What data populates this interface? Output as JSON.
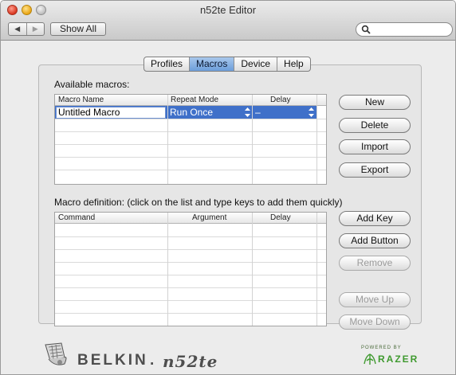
{
  "window": {
    "title": "n52te Editor"
  },
  "toolbar": {
    "show_all": "Show All",
    "search_placeholder": ""
  },
  "tabs": [
    {
      "label": "Profiles",
      "active": false
    },
    {
      "label": "Macros",
      "active": true
    },
    {
      "label": "Device",
      "active": false
    },
    {
      "label": "Help",
      "active": false
    }
  ],
  "macros": {
    "label": "Available macros:",
    "columns": [
      "Macro Name",
      "Repeat Mode",
      "Delay"
    ],
    "rows": [
      {
        "name": "Untitled Macro",
        "repeat_mode": "Run Once",
        "delay": "–"
      }
    ],
    "buttons": {
      "new": "New",
      "delete": "Delete",
      "import": "Import",
      "export": "Export"
    }
  },
  "definition": {
    "label": "Macro definition: (click on the list and type keys to add them quickly)",
    "columns": [
      "Command",
      "Argument",
      "Delay"
    ],
    "rows": [],
    "buttons": {
      "add_key": "Add Key",
      "add_button": "Add Button",
      "remove": "Remove",
      "move_up": "Move Up",
      "move_down": "Move Down"
    }
  },
  "footer": {
    "brand": "BELKIN",
    "brand_mark": ".",
    "product": "n52te",
    "powered_by": "POWERED BY",
    "partner": "RAZER"
  },
  "colors": {
    "selection": "#3f70c9",
    "active_tab": "#6c9edb",
    "razer_green": "#3f9a2f"
  }
}
